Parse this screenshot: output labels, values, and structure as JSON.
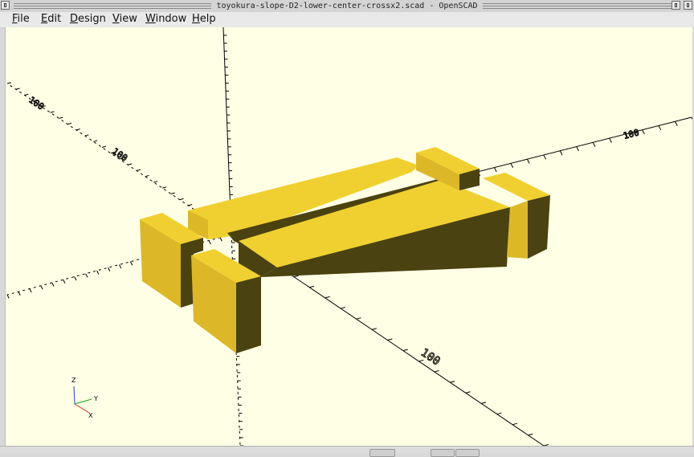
{
  "window": {
    "title": "toyokura-slope-D2-lower-center-crossx2.scad - OpenSCAD"
  },
  "menu": [
    {
      "mnemonic": "F",
      "rest": "ile"
    },
    {
      "mnemonic": "E",
      "rest": "dit"
    },
    {
      "mnemonic": "D",
      "rest": "esign"
    },
    {
      "mnemonic": "V",
      "rest": "iew"
    },
    {
      "mnemonic": "W",
      "rest": "indow"
    },
    {
      "mnemonic": "H",
      "rest": "elp"
    }
  ],
  "axes": {
    "labels": {
      "x": "X",
      "y": "Y",
      "z": "Z"
    },
    "tick_labels": {
      "x_pos": "100",
      "y_pos": "100",
      "y_neg": "100",
      "x_neg": "100"
    },
    "colors": {
      "x": "#e03030",
      "y": "#20a020",
      "z": "#2040e0"
    }
  },
  "model": {
    "colors": {
      "top": "#f0d030",
      "front": "#dcb828",
      "side": "#4a4210"
    }
  }
}
